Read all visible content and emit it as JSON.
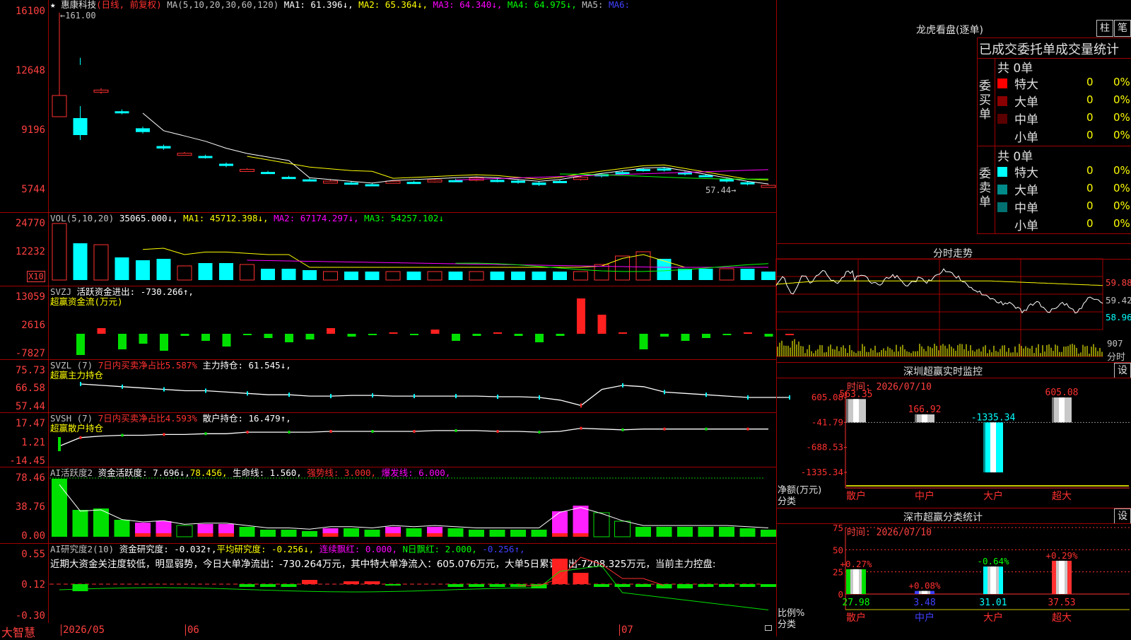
{
  "stock": {
    "name": "惠康科技",
    "mode": "(日线, 前复权)",
    "ma_label": "MA(5,10,20,30,60,120)",
    "ma1": "MA1: 61.396↓,",
    "ma2": "MA2: 65.364↓,",
    "ma3": "MA3: 64.340↓,",
    "ma4": "MA4: 64.975↓,",
    "ma5": "MA5:",
    "ma6": "MA6:",
    "high_label": "161.00",
    "low_label": "57.44"
  },
  "price_axis": [
    "16100",
    "12648",
    "9196",
    "5744"
  ],
  "vol": {
    "label": "VOL(5,10,20)",
    "value": "35065.000↓,",
    "ma1": "MA1: 45712.398↓,",
    "ma2": "MA2: 67174.297↓,",
    "ma3": "MA3: 54257.102↓",
    "axis": [
      "24770",
      "12232"
    ],
    "unit": "X10"
  },
  "svzj": {
    "label": "SVZJ",
    "desc": "活跃资金进出: -730.266↑,",
    "sub": "超赢资金流(万元)",
    "axis": [
      "13059",
      "2616",
      "-7827"
    ]
  },
  "svzl": {
    "label": "SVZL (7)",
    "desc1": "7日内买卖净占比5.587%",
    "desc2": "主力持仓: 61.545↓,",
    "sub": "超赢主力持仓",
    "axis": [
      "75.73",
      "66.58",
      "57.44"
    ]
  },
  "svsh": {
    "label": "SVSH (7)",
    "desc1": "7日内买卖净占比4.593%",
    "desc2": "散户持仓: 16.479↑,",
    "sub": "超赢散户持仓",
    "axis": [
      "17.47",
      "1.21",
      "-14.45"
    ]
  },
  "ai1": {
    "label": "AI活跃度2",
    "d1": "资金活跃度: 7.696↓,",
    "d2": "78.456,",
    "d3": "生命线: 1.560,",
    "d4": "强势线: 3.000,",
    "d5": "爆发线: 6.000,",
    "axis": [
      "78.46",
      "38.76",
      "0.00"
    ]
  },
  "ai2": {
    "label": "AI研究度2(10)",
    "d1": "资金研究度: -0.032↑,",
    "d2": "平均研究度: -0.256↓,",
    "d3": "连续飘红: 0.000,",
    "d4": "N日飘红: 2.000,",
    "d5": "-0.256↑,",
    "comment": "近期大资金关注度较低，明显弱势，今日大单净流出：-730.264万元，其中特大单净流入：605.076万元，大单5日累计净出-7208.325万元，当前主力控盘:",
    "axis": [
      "0.55",
      "0.12",
      "-0.30"
    ]
  },
  "xaxis": {
    "brand": "大智慧",
    "d1": "2026/05",
    "d2": "06",
    "d3": "07"
  },
  "lhb": {
    "title": "龙虎看盘(逐单)",
    "btn1": "柱",
    "btn2": "笔",
    "header": "已成交委托单成交量统计",
    "buy_label": "委买单",
    "sell_label": "委卖单",
    "buy_total": "共 0单",
    "sell_total": "共 0单",
    "buy_rows": [
      {
        "name": "特大",
        "n": "0",
        "p": "0%",
        "color": "#ff0000"
      },
      {
        "name": "大单",
        "n": "0",
        "p": "0%",
        "color": "#8b0000"
      },
      {
        "name": "中单",
        "n": "0",
        "p": "0%",
        "color": "#5a0000"
      },
      {
        "name": "小单",
        "n": "0",
        "p": "0%",
        "color": "#000000"
      }
    ],
    "sell_rows": [
      {
        "name": "特大",
        "n": "0",
        "p": "0%",
        "color": "#00ffff"
      },
      {
        "name": "大单",
        "n": "0",
        "p": "0%",
        "color": "#008b8b"
      },
      {
        "name": "中单",
        "n": "0",
        "p": "0%",
        "color": "#007070"
      },
      {
        "name": "小单",
        "n": "0",
        "p": "0%",
        "color": "#000000"
      }
    ]
  },
  "fenshi": {
    "title": "分时走势",
    "axis": [
      "59.88",
      "59.42",
      "58.96"
    ],
    "vol_label": "907",
    "unit": "分时"
  },
  "monitor": {
    "title": "深圳超赢实时监控",
    "btn": "设",
    "time": "时间: 2026/07/10",
    "axis": [
      "605.08",
      "-41.79",
      "-688.53",
      "-1335.34"
    ],
    "ylabel": "净额(万元)",
    "xlabel": "分类",
    "chart_data": {
      "type": "bar",
      "categories": [
        "散户",
        "中户",
        "大户",
        "超大"
      ],
      "values": [
        563.35,
        166.92,
        -1335.34,
        605.08
      ],
      "labels": [
        "563.35",
        "166.92",
        "-1335.34",
        "605.08"
      ],
      "ylim": [
        -1335.34,
        605.08
      ]
    }
  },
  "stat": {
    "title": "深市超赢分类统计",
    "btn": "设",
    "time": "时间: 2026/07/10",
    "axis": [
      "75",
      "50",
      "25",
      "0"
    ],
    "ylabel": "比例%",
    "xlabel": "分类",
    "chart_data": {
      "type": "bar",
      "categories": [
        "散户",
        "中户",
        "大户",
        "超大"
      ],
      "values": [
        27.98,
        3.48,
        31.01,
        37.53
      ],
      "changes": [
        "+0.27%",
        "+0.08%",
        "-0.64%",
        "+0.29%"
      ],
      "ylim": [
        0,
        75
      ]
    }
  }
}
